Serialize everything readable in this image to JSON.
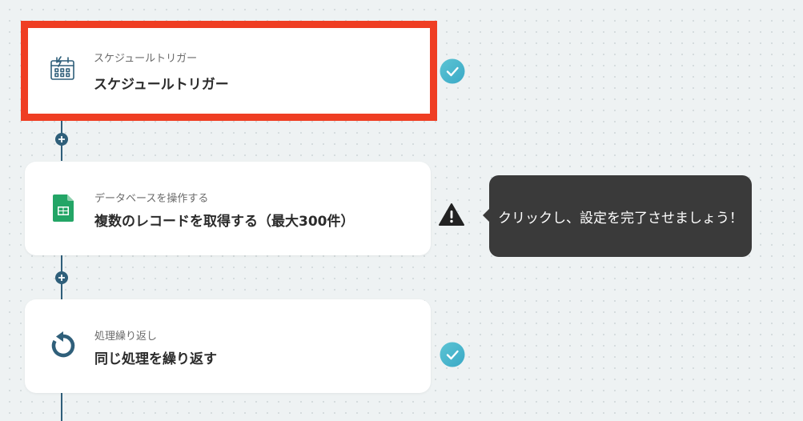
{
  "steps": [
    {
      "category": "スケジュールトリガー",
      "title": "スケジュールトリガー",
      "icon": "schedule-trigger-icon",
      "status": "complete",
      "selected": true
    },
    {
      "category": "データベースを操作する",
      "title": "複数のレコードを取得する（最大300件）",
      "icon": "google-sheets-icon",
      "status": "warning",
      "selected": false
    },
    {
      "category": "処理繰り返し",
      "title": "同じ処理を繰り返す",
      "icon": "loop-icon",
      "status": "complete",
      "selected": false
    }
  ],
  "tooltip": {
    "text": "クリックし、設定を完了させましょう！"
  },
  "colors": {
    "connector": "#2f5f7a",
    "selection_border": "#ef3e23",
    "check_badge": "#4bb8d0",
    "sheets_green": "#23a566",
    "tooltip_bg": "#3a3a3a"
  }
}
